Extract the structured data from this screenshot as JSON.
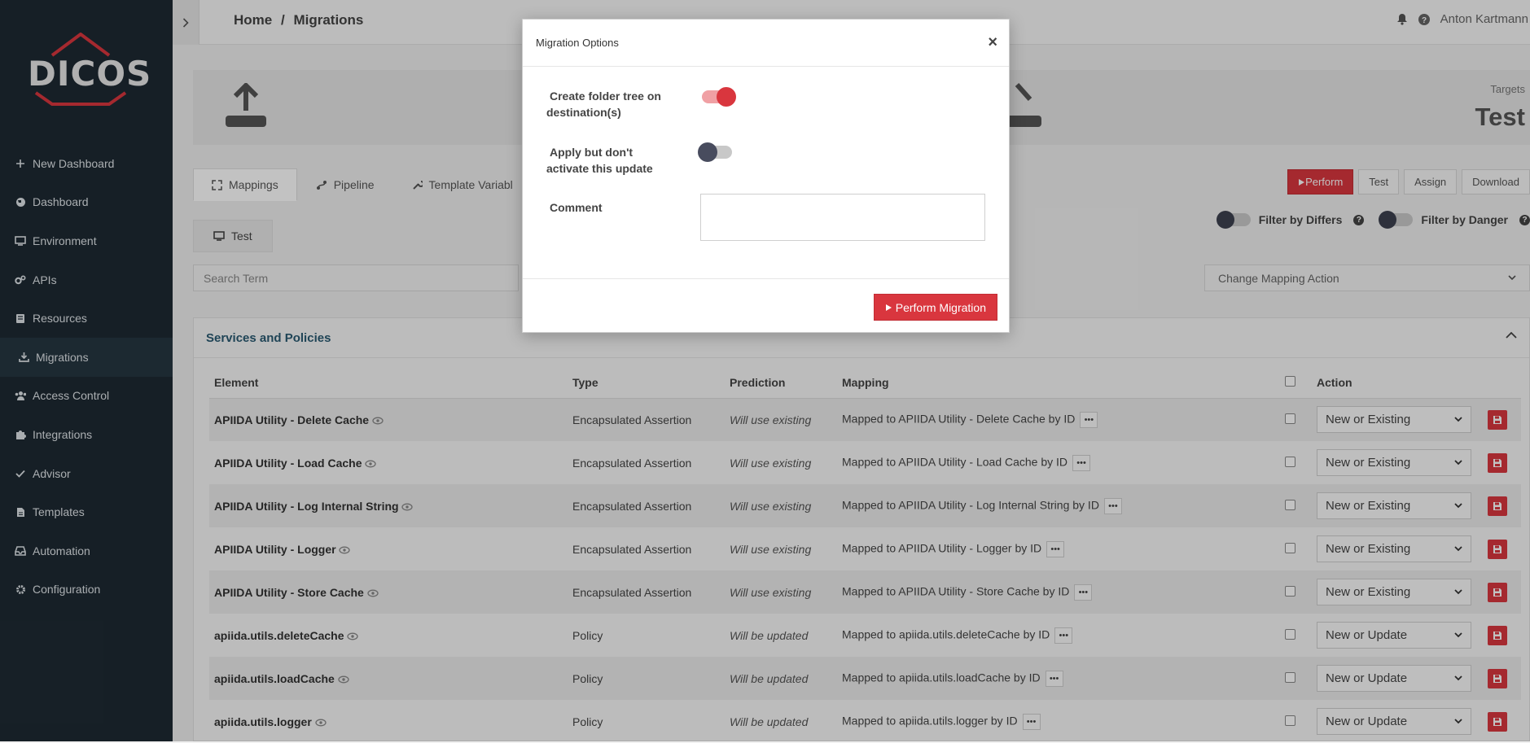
{
  "app": {
    "logo_text": "DICOS"
  },
  "sidebar": {
    "items": [
      {
        "label": "New Dashboard",
        "icon": "plus-icon"
      },
      {
        "label": "Dashboard",
        "icon": "globe-icon"
      },
      {
        "label": "Environment",
        "icon": "monitor-icon"
      },
      {
        "label": "APIs",
        "icon": "cogs-icon"
      },
      {
        "label": "Resources",
        "icon": "book-icon"
      },
      {
        "label": "Migrations",
        "icon": "download-icon",
        "active": true
      },
      {
        "label": "Access Control",
        "icon": "users-icon"
      },
      {
        "label": "Integrations",
        "icon": "puzzle-icon"
      },
      {
        "label": "Advisor",
        "icon": "check-icon"
      },
      {
        "label": "Templates",
        "icon": "file-icon"
      },
      {
        "label": "Automation",
        "icon": "inbox-icon"
      },
      {
        "label": "Configuration",
        "icon": "gear-icon"
      }
    ]
  },
  "header": {
    "breadcrumb_home": "Home",
    "breadcrumb_sep": "/",
    "breadcrumb_current": "Migrations",
    "user": "Anton Kartmann"
  },
  "hero": {
    "targets_label": "Targets",
    "targets_value": "Test"
  },
  "tabs": [
    {
      "label": "Mappings",
      "icon": "arrows-icon"
    },
    {
      "label": "Pipeline",
      "icon": "pipeline-icon"
    },
    {
      "label": "Template Variabl",
      "icon": "wrench-icon"
    }
  ],
  "subtab": {
    "label": "Test"
  },
  "actions": {
    "perform": "Perform",
    "test": "Test",
    "assign": "Assign",
    "download": "Download"
  },
  "filters": {
    "differs": "Filter by Differs",
    "danger": "Filter by Danger"
  },
  "search": {
    "placeholder": "Search Term"
  },
  "change_action": {
    "placeholder": "Change Mapping Action"
  },
  "panel": {
    "title": "Services and Policies",
    "columns": {
      "element": "Element",
      "type": "Type",
      "prediction": "Prediction",
      "mapping": "Mapping",
      "action": "Action"
    },
    "rows": [
      {
        "element": "APIIDA Utility - Delete Cache",
        "type": "Encapsulated Assertion",
        "prediction": "Will use existing",
        "mapping": "Mapped to APIIDA Utility - Delete Cache by ID",
        "action": "New or Existing"
      },
      {
        "element": "APIIDA Utility - Load Cache",
        "type": "Encapsulated Assertion",
        "prediction": "Will use existing",
        "mapping": "Mapped to APIIDA Utility - Load Cache by ID",
        "action": "New or Existing"
      },
      {
        "element": "APIIDA Utility - Log Internal String",
        "type": "Encapsulated Assertion",
        "prediction": "Will use existing",
        "mapping": "Mapped to APIIDA Utility - Log Internal String by ID",
        "action": "New or Existing"
      },
      {
        "element": "APIIDA Utility - Logger",
        "type": "Encapsulated Assertion",
        "prediction": "Will use existing",
        "mapping": "Mapped to APIIDA Utility - Logger by ID",
        "action": "New or Existing"
      },
      {
        "element": "APIIDA Utility - Store Cache",
        "type": "Encapsulated Assertion",
        "prediction": "Will use existing",
        "mapping": "Mapped to APIIDA Utility - Store Cache by ID",
        "action": "New or Existing"
      },
      {
        "element": "apiida.utils.deleteCache",
        "type": "Policy",
        "prediction": "Will be updated",
        "mapping": "Mapped to apiida.utils.deleteCache by ID",
        "action": "New or Update"
      },
      {
        "element": "apiida.utils.loadCache",
        "type": "Policy",
        "prediction": "Will be updated",
        "mapping": "Mapped to apiida.utils.loadCache by ID",
        "action": "New or Update"
      },
      {
        "element": "apiida.utils.logger",
        "type": "Policy",
        "prediction": "Will be updated",
        "mapping": "Mapped to apiida.utils.logger by ID",
        "action": "New or Update"
      }
    ]
  },
  "modal": {
    "title": "Migration Options",
    "close": "×",
    "folder_tree_label_1": "Create folder tree on",
    "folder_tree_label_2": "destination(s)",
    "folder_tree_on": true,
    "apply_label_1": "Apply but don't",
    "apply_label_2": "activate this update",
    "apply_on": false,
    "comment_label": "Comment",
    "comment_value": "",
    "perform_button": "Perform Migration"
  },
  "colors": {
    "accent": "#d9363e",
    "sidebar": "#1e2a33"
  }
}
